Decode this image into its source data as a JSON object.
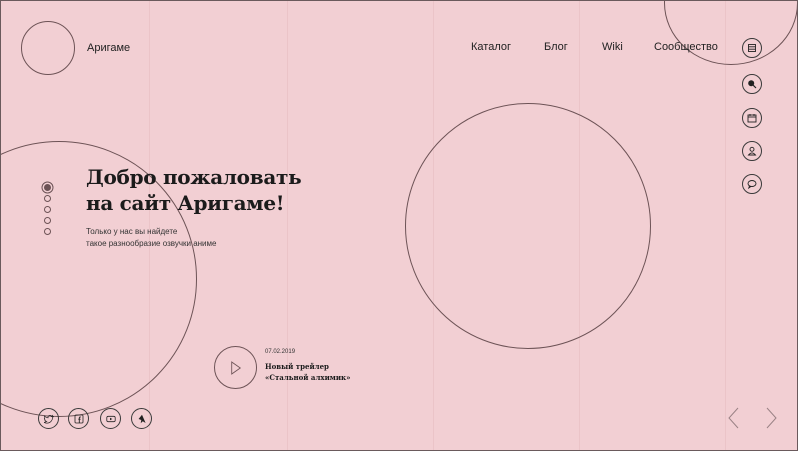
{
  "header": {
    "logo_text": "Аригаме",
    "nav": [
      "Каталог",
      "Блог",
      "Wiki",
      "Сообщество"
    ]
  },
  "side_icons": [
    "menu-icon",
    "search-icon",
    "calendar-icon",
    "user-icon",
    "chat-icon"
  ],
  "hero": {
    "title_line1": "Добро пожаловать",
    "title_line2": "на сайт Аригаме!",
    "subtitle_line1": "Только у нас вы найдете",
    "subtitle_line2": "такое разнообразие озвучки аниме"
  },
  "slider": {
    "count": 5,
    "active_index": 0
  },
  "trailer": {
    "date": "07.02.2019",
    "title_line1": "Новый трейлер",
    "title_line2": "«Стальной алхимик»"
  },
  "social": [
    "twitter-icon",
    "facebook-icon",
    "youtube-icon",
    "shikimori-icon"
  ],
  "colors": {
    "background": "#f2cfd3",
    "line": "#6d5356",
    "text": "#222222"
  }
}
